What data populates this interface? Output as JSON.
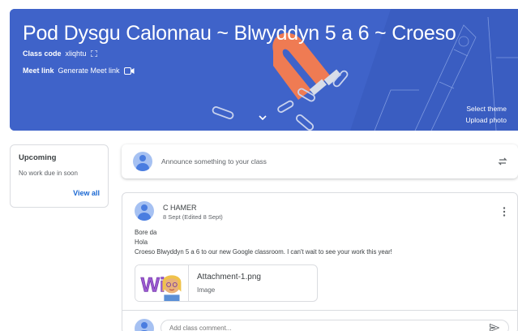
{
  "header": {
    "class_title": "Pod Dysgu Calonnau ~ Blwyddyn 5 a 6 ~ Croeso",
    "class_code_label": "Class code",
    "class_code": "xliqhtu",
    "meet_label": "Meet link",
    "meet_action": "Generate Meet link",
    "select_theme": "Select theme",
    "upload_photo": "Upload photo",
    "banner_color": "#3f63c9"
  },
  "upcoming": {
    "title": "Upcoming",
    "empty_text": "No work due in soon",
    "view_all": "View all"
  },
  "announce": {
    "placeholder": "Announce something to your class"
  },
  "post": {
    "author": "C HAMER",
    "date": "8 Sept (Edited 8 Sept)",
    "lines": [
      "Bore da",
      "Hola",
      "Croeso Blwyddyn 5 a 6 to our new Google classroom. I can't wait to see your work this year!"
    ],
    "attachment": {
      "name": "Attachment-1.png",
      "type": "Image"
    },
    "comment_placeholder": "Add class comment..."
  },
  "icons": {
    "fullscreen": "fullscreen-icon",
    "camera": "video-camera-icon",
    "expand": "chevron-down-icon",
    "repost": "repost-icon",
    "more": "more-vert-icon",
    "send": "send-icon"
  },
  "colors": {
    "link": "#1967d2",
    "avatar": "#a6c1f2"
  }
}
